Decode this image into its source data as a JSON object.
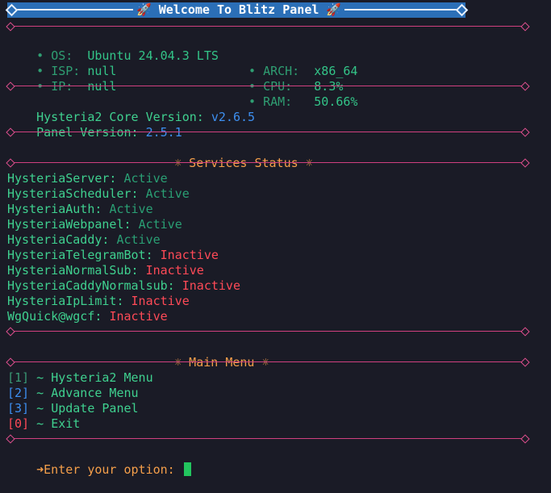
{
  "banner": {
    "title": "🚀 Welcome To Blitz Panel 🚀"
  },
  "system_info": {
    "left": [
      {
        "label": "OS:",
        "value": "Ubuntu 24.04.3 LTS"
      },
      {
        "label": "ISP:",
        "value": "null"
      },
      {
        "label": "IP:",
        "value": "null"
      }
    ],
    "right": [
      {
        "label": "ARCH:",
        "value": "x86_64"
      },
      {
        "label": "CPU:",
        "value": "8.3%"
      },
      {
        "label": "RAM:",
        "value": "50.66%"
      }
    ],
    "bullet": "•"
  },
  "versions": {
    "core_label": "Hysteria2 Core Version:",
    "core_value": "v2.6.5",
    "panel_label": "Panel Version:",
    "panel_value": "2.5.1"
  },
  "services": {
    "header": "☼ Services Status ☼",
    "items": [
      {
        "name": "HysteriaServer:",
        "status": "Active"
      },
      {
        "name": "HysteriaScheduler:",
        "status": "Active"
      },
      {
        "name": "HysteriaAuth:",
        "status": "Active"
      },
      {
        "name": "HysteriaWebpanel:",
        "status": "Active"
      },
      {
        "name": "HysteriaCaddy:",
        "status": "Active"
      },
      {
        "name": "HysteriaTelegramBot:",
        "status": "Inactive"
      },
      {
        "name": "HysteriaNormalSub:",
        "status": "Inactive"
      },
      {
        "name": "HysteriaCaddyNormalsub:",
        "status": "Inactive"
      },
      {
        "name": "HysteriaIpLimit:",
        "status": "Inactive"
      },
      {
        "name": "WgQuick@wgcf:",
        "status": "Inactive"
      }
    ]
  },
  "menu": {
    "header": "☼ Main Menu ☼",
    "items": [
      {
        "key": "[1]",
        "arrow": "~",
        "label": "Hysteria2 Menu"
      },
      {
        "key": "[2]",
        "arrow": "~",
        "label": "Advance Menu"
      },
      {
        "key": "[3]",
        "arrow": "~",
        "label": "Update Panel"
      },
      {
        "key": "[0]",
        "arrow": "~",
        "label": "Exit"
      }
    ]
  },
  "prompt": {
    "arrow": "➜",
    "text": "Enter your option:"
  },
  "colors": {
    "background": "#1a1b26",
    "banner": "#2b6fb7",
    "divider": "#d0407f",
    "active": "#2a9f74",
    "inactive": "#ff4a57",
    "accent_blue": "#3d8ff0",
    "accent_orange": "#f59f4a",
    "cursor": "#22c55e"
  }
}
